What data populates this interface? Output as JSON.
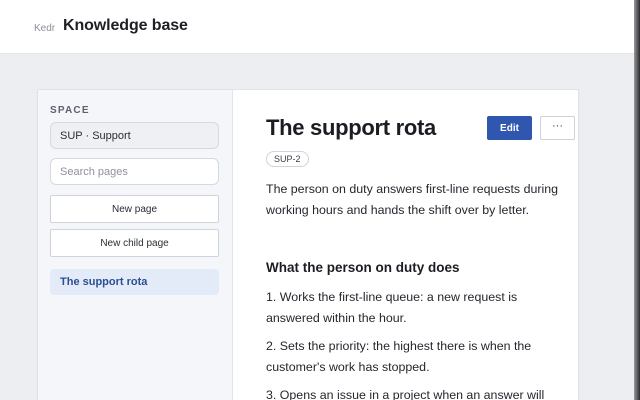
{
  "header": {
    "brand": "Kedr",
    "title": "Knowledge base"
  },
  "sidebar": {
    "space_heading": "SPACE",
    "space_value": "SUP · Support",
    "search_placeholder": "Search pages",
    "new_page_label": "New page",
    "new_child_label": "New child page",
    "pages": [
      {
        "label": "The support rota",
        "selected": true
      }
    ]
  },
  "page": {
    "title": "The support rota",
    "key": "SUP-2",
    "edit_label": "Edit",
    "more_label": "···",
    "intro": "The person on duty answers first-line requests during working hours and hands the shift over by letter.",
    "section_heading": "What the person on duty does",
    "steps": [
      "1. Works the first-line queue: a new request is answered within the hour.",
      "2. Sets the priority: the highest there is when the customer's work has stopped.",
      "3. Opens an issue in a project when an answer will"
    ]
  },
  "colors": {
    "accent": "#2f57b0",
    "selected_bg": "#e4ebf8",
    "selected_text": "#2b4f92"
  }
}
